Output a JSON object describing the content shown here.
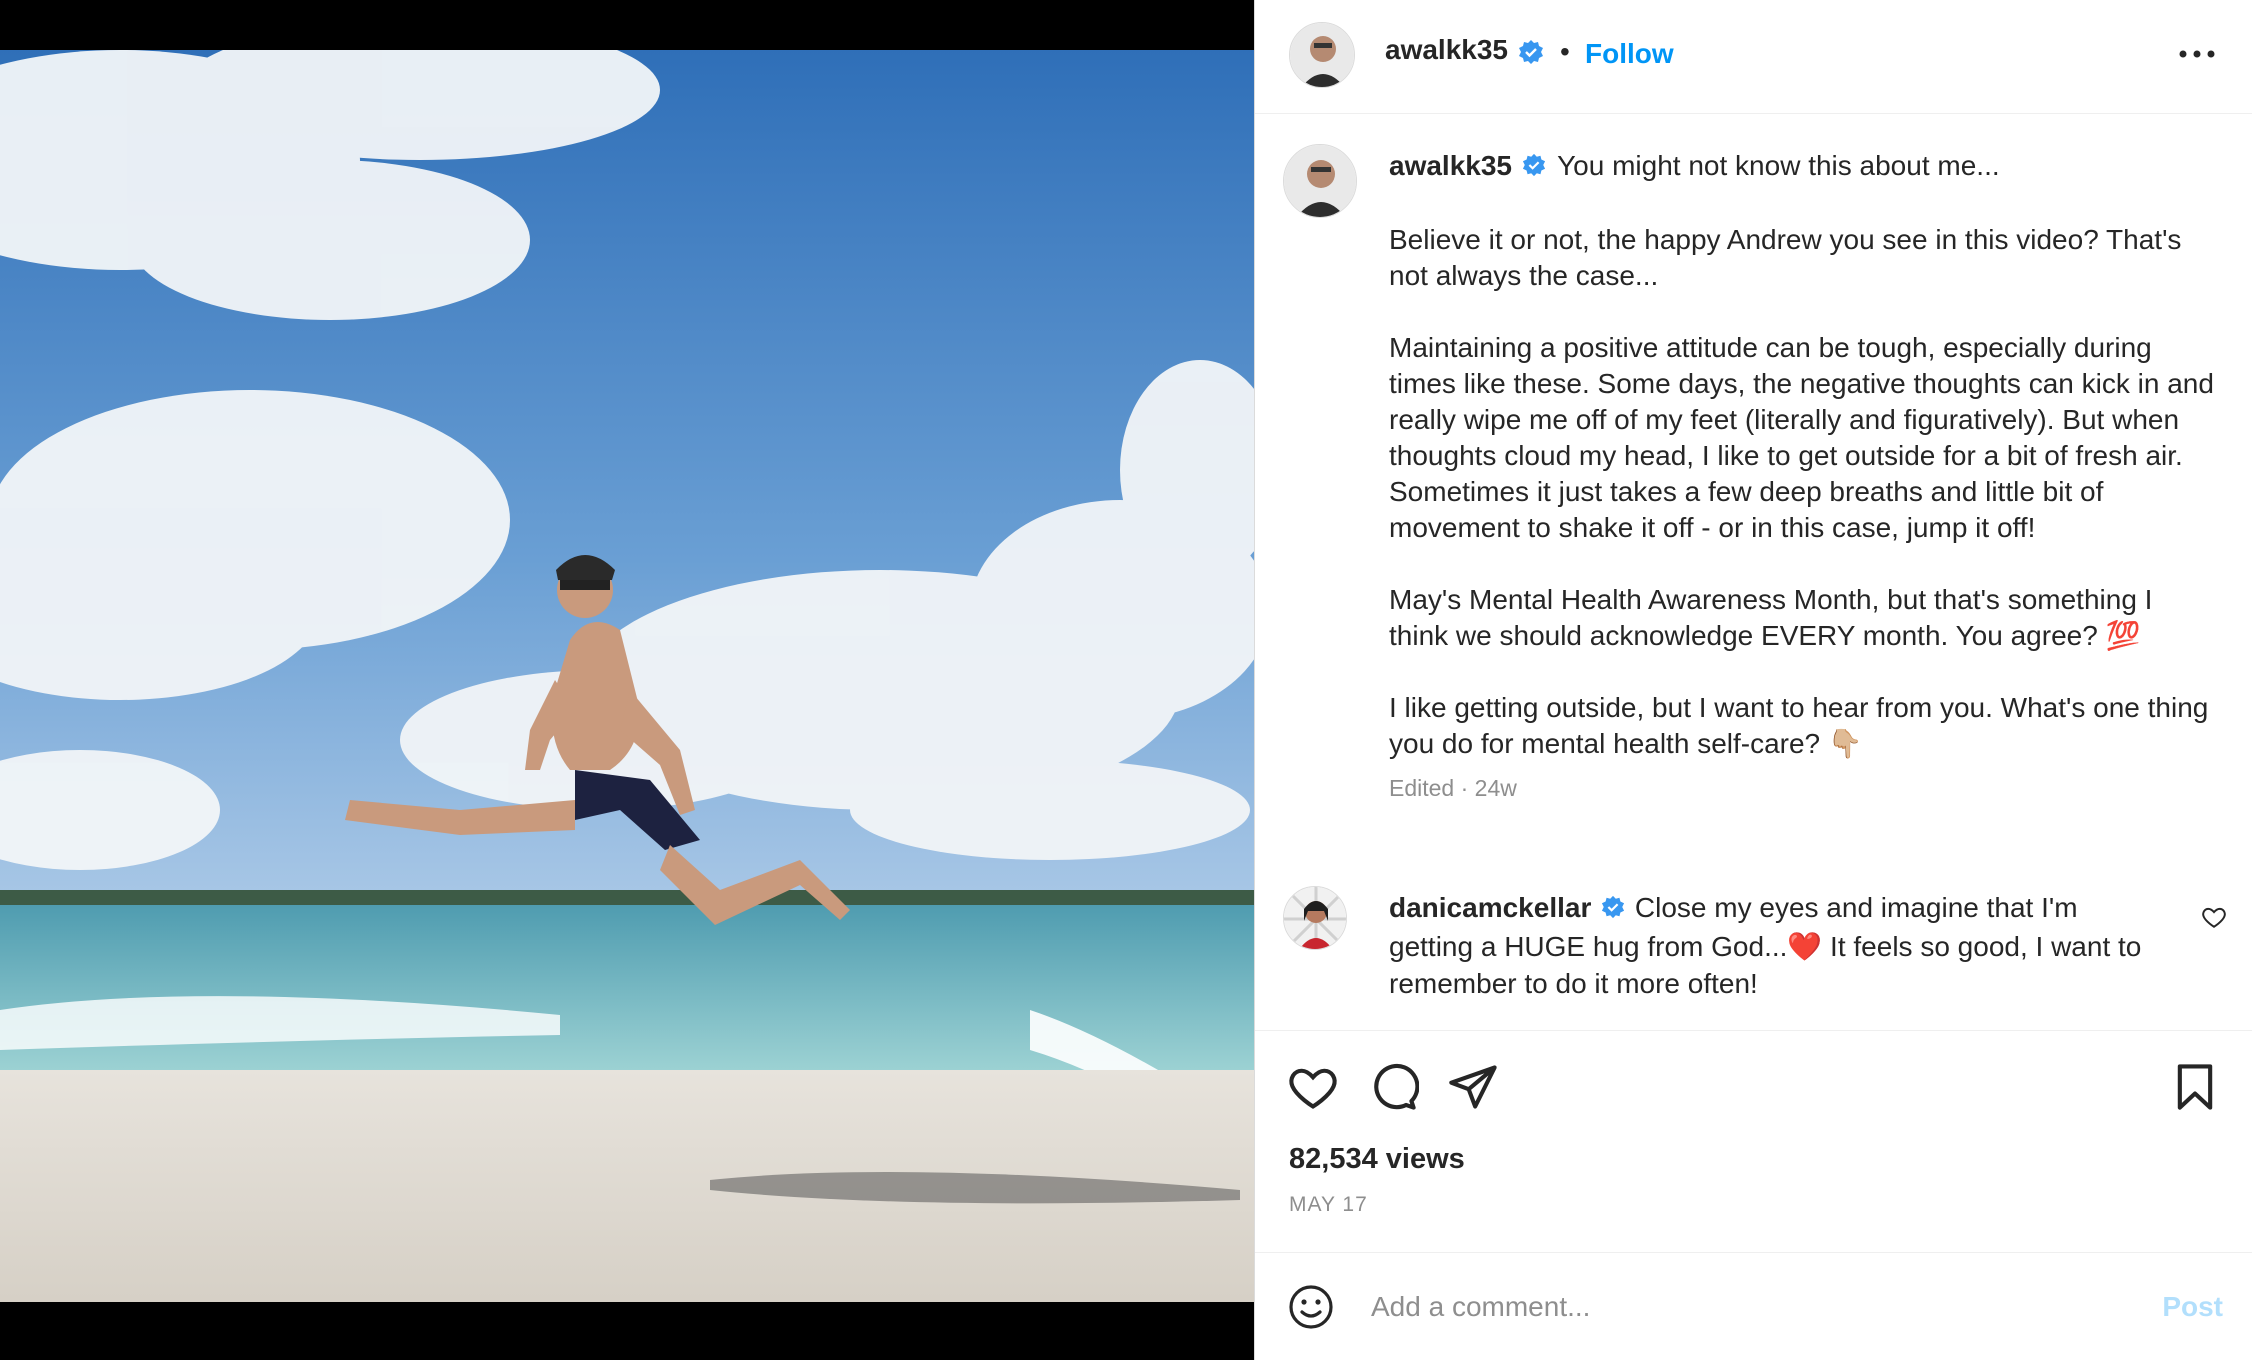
{
  "post": {
    "author": "awalkk35",
    "follow_label": "Follow",
    "separator": "•",
    "caption_intro": "You might not know this about me...",
    "caption_paragraphs": [
      "Believe it or not, the happy Andrew you see in this video? That's not always the case...",
      "Maintaining a positive attitude can be tough, especially during times like these. Some days, the negative thoughts can kick in and really wipe me off of my feet (literally and figuratively). But when thoughts cloud my head, I like to get outside for a bit of fresh air. Sometimes it just takes a few deep breaths and little bit of movement to shake it off - or in this case, jump it off!",
      "May's Mental Health Awareness Month, but that's something I think we should acknowledge EVERY month. You agree? 💯",
      "I like getting outside, but I want to hear from you. What's one thing you do for mental health self-care? 👇🏼"
    ],
    "caption_meta": "Edited · 24w",
    "views": "82,534 views",
    "date": "MAY 17"
  },
  "comments": [
    {
      "author": "danicamckellar",
      "text": "Close my eyes and imagine that I'm getting a HUGE hug from God...❤️ It feels so good, I want to remember to do it more often!"
    }
  ],
  "add_comment": {
    "placeholder": "Add a comment...",
    "post_label": "Post"
  },
  "icons": [
    "verified-badge-icon",
    "more-options-icon",
    "heart-icon",
    "comment-icon",
    "share-icon",
    "bookmark-icon",
    "emoji-icon"
  ],
  "colors": {
    "link_blue": "#0095f6",
    "verified_blue": "#3897f0",
    "post_disabled": "#b2dffc",
    "secondary_text": "#8e8e8e"
  }
}
